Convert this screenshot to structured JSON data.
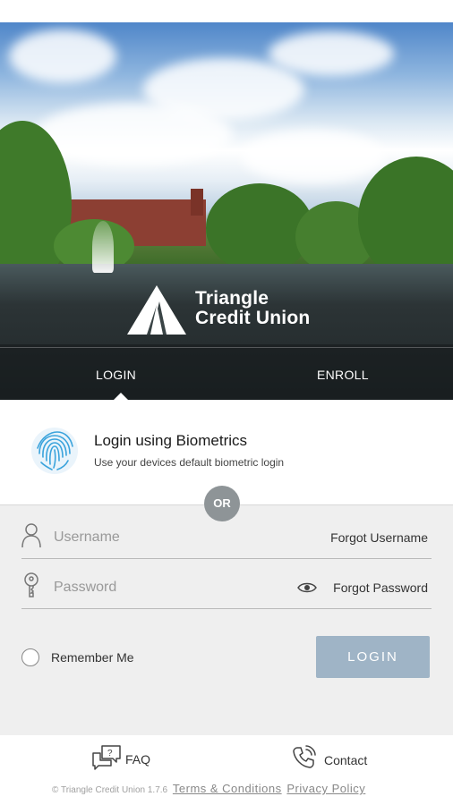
{
  "brand": {
    "name_line1": "Triangle",
    "name_line2": "Credit Union",
    "accent": "#9fb4c6"
  },
  "tabs": [
    {
      "label": "LOGIN",
      "active": true
    },
    {
      "label": "ENROLL",
      "active": false
    }
  ],
  "biometrics": {
    "title": "Login using Biometrics",
    "subtitle": "Use your devices default biometric login",
    "icon": "fingerprint-icon"
  },
  "divider": {
    "label": "OR"
  },
  "form": {
    "username": {
      "placeholder": "Username",
      "value": "",
      "icon": "user-icon",
      "forgot_label": "Forgot Username"
    },
    "password": {
      "placeholder": "Password",
      "value": "",
      "icon": "key-icon",
      "reveal_icon": "eye-icon",
      "forgot_label": "Forgot Password"
    },
    "remember_label": "Remember Me",
    "remember_checked": false,
    "login_button": "LOGIN"
  },
  "footer": {
    "faq_label": "FAQ",
    "faq_icon": "chat-question-icon",
    "contact_label": "Contact",
    "contact_icon": "phone-icon",
    "copyright": "© Triangle Credit Union 1.7.6",
    "terms_label": "Terms & Conditions",
    "privacy_label": "Privacy Policy"
  }
}
